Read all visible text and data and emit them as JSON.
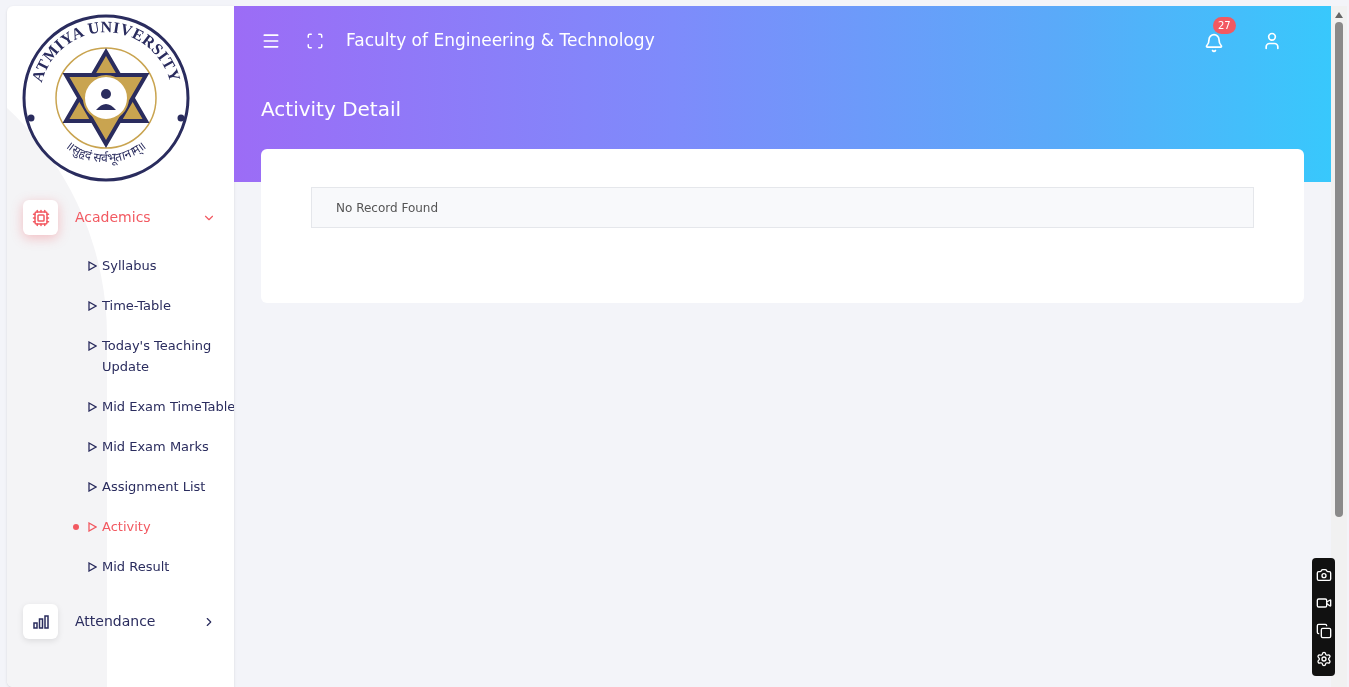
{
  "logo": {
    "ring_text": "ATMIYA UNIVERSITY",
    "motto": "॥सुहृदं सर्वभूतानाम्॥"
  },
  "sidebar": {
    "items": [
      {
        "label": "Academics",
        "kind": "chip",
        "selected": true,
        "expanded": true,
        "children": [
          {
            "label": "Syllabus",
            "selected": false
          },
          {
            "label": "Time-Table",
            "selected": false
          },
          {
            "label": "Today's Teaching Update",
            "selected": false
          },
          {
            "label": "Mid Exam TimeTable",
            "selected": false
          },
          {
            "label": "Mid Exam Marks",
            "selected": false
          },
          {
            "label": "Assignment List",
            "selected": false
          },
          {
            "label": "Activity",
            "selected": true
          },
          {
            "label": "Mid Result",
            "selected": false
          }
        ]
      },
      {
        "label": "Attendance",
        "kind": "bars",
        "selected": false,
        "expanded": false
      }
    ]
  },
  "header": {
    "title": "Faculty of Engineering & Technology",
    "notification_count": "27"
  },
  "page": {
    "title": "Activity Detail",
    "message": "No Record Found"
  }
}
